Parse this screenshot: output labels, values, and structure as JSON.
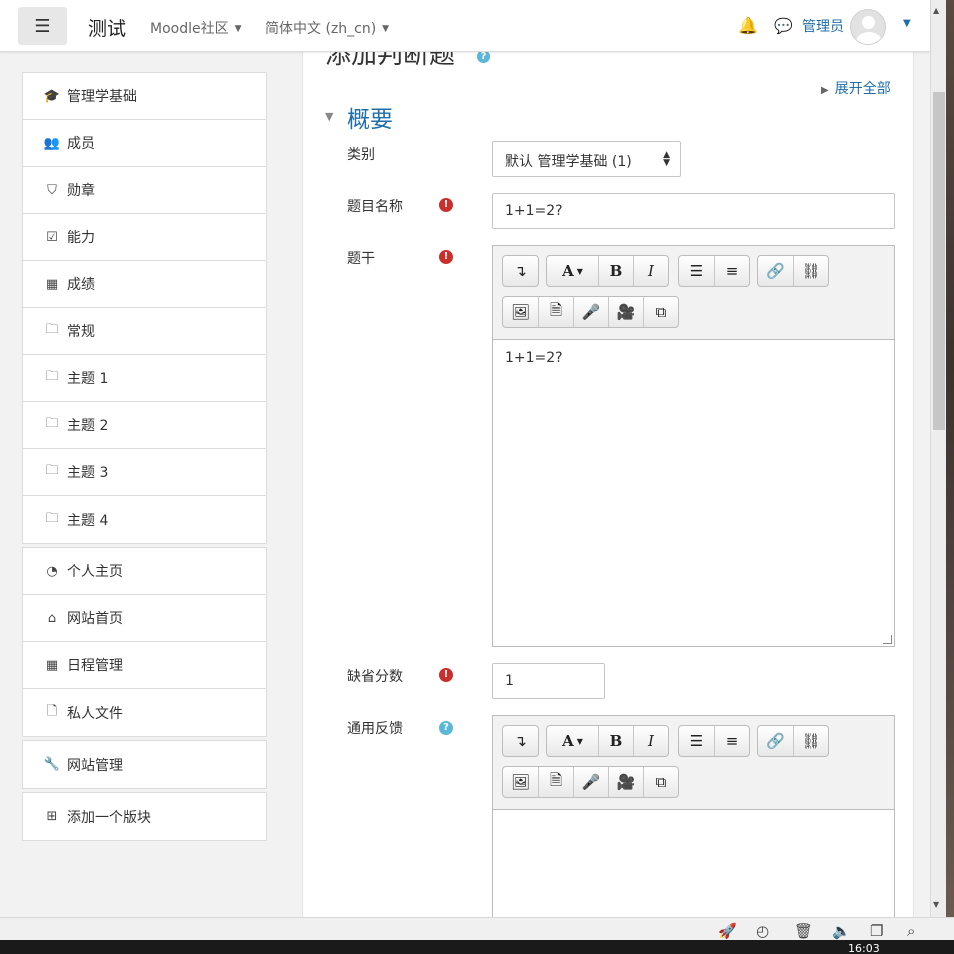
{
  "navbar": {
    "menu_icon": "hamburger-icon",
    "site_name": "测试",
    "menu_moodle": "Moodle社区",
    "menu_lang": "简体中文 (zh_cn)",
    "username": "管理员"
  },
  "sidebar": {
    "course_items": [
      {
        "label": "管理学基础",
        "icon": "graduation-cap-icon"
      },
      {
        "label": "成员",
        "icon": "users-icon"
      },
      {
        "label": "勋章",
        "icon": "shield-icon"
      },
      {
        "label": "能力",
        "icon": "checkbox-icon"
      },
      {
        "label": "成绩",
        "icon": "table-icon"
      },
      {
        "label": "常规",
        "icon": "folder-icon"
      },
      {
        "label": "主题 1",
        "icon": "folder-icon"
      },
      {
        "label": "主题 2",
        "icon": "folder-icon"
      },
      {
        "label": "主题 3",
        "icon": "folder-icon"
      },
      {
        "label": "主题 4",
        "icon": "folder-icon"
      }
    ],
    "site_items": [
      {
        "label": "个人主页",
        "icon": "dashboard-icon"
      },
      {
        "label": "网站首页",
        "icon": "home-icon"
      },
      {
        "label": "日程管理",
        "icon": "calendar-icon"
      },
      {
        "label": "私人文件",
        "icon": "file-icon"
      }
    ],
    "admin_item": {
      "label": "网站管理",
      "icon": "wrench-icon"
    },
    "add_block": {
      "label": "添加一个版块",
      "icon": "plus-square-icon"
    }
  },
  "main": {
    "page_title": "添加判断题",
    "expand_all": "展开全部",
    "section_title": "概要",
    "fields": {
      "category_label": "类别",
      "category_value": "默认 管理学基础 (1)",
      "name_label": "题目名称",
      "name_value": "1+1=2?",
      "stem_label": "题干",
      "stem_value": "1+1=2?",
      "score_label": "缺省分数",
      "score_value": "1",
      "feedback_label": "通用反馈",
      "feedback_value": ""
    }
  },
  "colors": {
    "accent": "#1f6ea8",
    "required": "#c9302c",
    "help": "#5bb7d6"
  }
}
